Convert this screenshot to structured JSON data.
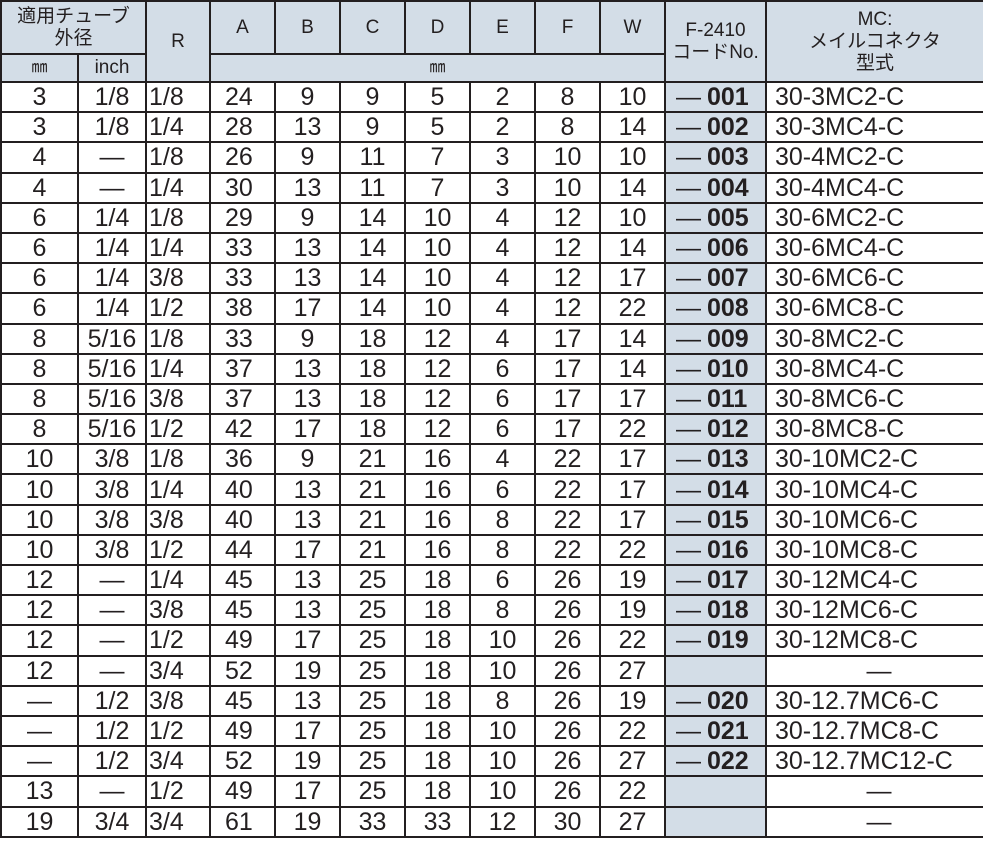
{
  "header": {
    "tube_od": "適用チューブ\n外径",
    "r": "R",
    "a": "A",
    "b": "B",
    "c": "C",
    "d": "D",
    "e": "E",
    "f": "F",
    "w": "W",
    "code": "F-2410\nコードNo.",
    "model": "MC:\nメイルコネクタ\n型式",
    "mm": "㎜",
    "inch": "inch",
    "dims_unit": "㎜"
  },
  "dash": "—",
  "rows": [
    {
      "mm": "3",
      "inch": "1/8",
      "r": "1/8",
      "a": "24",
      "b": "9",
      "c": "9",
      "d": "5",
      "e": "2",
      "f": "8",
      "w": "10",
      "code": "001",
      "model": "30-3MC2-C"
    },
    {
      "mm": "3",
      "inch": "1/8",
      "r": "1/4",
      "a": "28",
      "b": "13",
      "c": "9",
      "d": "5",
      "e": "2",
      "f": "8",
      "w": "14",
      "code": "002",
      "model": "30-3MC4-C"
    },
    {
      "mm": "4",
      "inch": "—",
      "r": "1/8",
      "a": "26",
      "b": "9",
      "c": "11",
      "d": "7",
      "e": "3",
      "f": "10",
      "w": "10",
      "code": "003",
      "model": "30-4MC2-C"
    },
    {
      "mm": "4",
      "inch": "—",
      "r": "1/4",
      "a": "30",
      "b": "13",
      "c": "11",
      "d": "7",
      "e": "3",
      "f": "10",
      "w": "14",
      "code": "004",
      "model": "30-4MC4-C"
    },
    {
      "mm": "6",
      "inch": "1/4",
      "r": "1/8",
      "a": "29",
      "b": "9",
      "c": "14",
      "d": "10",
      "e": "4",
      "f": "12",
      "w": "10",
      "code": "005",
      "model": "30-6MC2-C"
    },
    {
      "mm": "6",
      "inch": "1/4",
      "r": "1/4",
      "a": "33",
      "b": "13",
      "c": "14",
      "d": "10",
      "e": "4",
      "f": "12",
      "w": "14",
      "code": "006",
      "model": "30-6MC4-C"
    },
    {
      "mm": "6",
      "inch": "1/4",
      "r": "3/8",
      "a": "33",
      "b": "13",
      "c": "14",
      "d": "10",
      "e": "4",
      "f": "12",
      "w": "17",
      "code": "007",
      "model": "30-6MC6-C"
    },
    {
      "mm": "6",
      "inch": "1/4",
      "r": "1/2",
      "a": "38",
      "b": "17",
      "c": "14",
      "d": "10",
      "e": "4",
      "f": "12",
      "w": "22",
      "code": "008",
      "model": "30-6MC8-C"
    },
    {
      "mm": "8",
      "inch": "5/16",
      "r": "1/8",
      "a": "33",
      "b": "9",
      "c": "18",
      "d": "12",
      "e": "4",
      "f": "17",
      "w": "14",
      "code": "009",
      "model": "30-8MC2-C"
    },
    {
      "mm": "8",
      "inch": "5/16",
      "r": "1/4",
      "a": "37",
      "b": "13",
      "c": "18",
      "d": "12",
      "e": "6",
      "f": "17",
      "w": "14",
      "code": "010",
      "model": "30-8MC4-C"
    },
    {
      "mm": "8",
      "inch": "5/16",
      "r": "3/8",
      "a": "37",
      "b": "13",
      "c": "18",
      "d": "12",
      "e": "6",
      "f": "17",
      "w": "17",
      "code": "011",
      "model": "30-8MC6-C"
    },
    {
      "mm": "8",
      "inch": "5/16",
      "r": "1/2",
      "a": "42",
      "b": "17",
      "c": "18",
      "d": "12",
      "e": "6",
      "f": "17",
      "w": "22",
      "code": "012",
      "model": "30-8MC8-C"
    },
    {
      "mm": "10",
      "inch": "3/8",
      "r": "1/8",
      "a": "36",
      "b": "9",
      "c": "21",
      "d": "16",
      "e": "4",
      "f": "22",
      "w": "17",
      "code": "013",
      "model": "30-10MC2-C"
    },
    {
      "mm": "10",
      "inch": "3/8",
      "r": "1/4",
      "a": "40",
      "b": "13",
      "c": "21",
      "d": "16",
      "e": "6",
      "f": "22",
      "w": "17",
      "code": "014",
      "model": "30-10MC4-C"
    },
    {
      "mm": "10",
      "inch": "3/8",
      "r": "3/8",
      "a": "40",
      "b": "13",
      "c": "21",
      "d": "16",
      "e": "8",
      "f": "22",
      "w": "17",
      "code": "015",
      "model": "30-10MC6-C"
    },
    {
      "mm": "10",
      "inch": "3/8",
      "r": "1/2",
      "a": "44",
      "b": "17",
      "c": "21",
      "d": "16",
      "e": "8",
      "f": "22",
      "w": "22",
      "code": "016",
      "model": "30-10MC8-C"
    },
    {
      "mm": "12",
      "inch": "—",
      "r": "1/4",
      "a": "45",
      "b": "13",
      "c": "25",
      "d": "18",
      "e": "6",
      "f": "26",
      "w": "19",
      "code": "017",
      "model": "30-12MC4-C"
    },
    {
      "mm": "12",
      "inch": "—",
      "r": "3/8",
      "a": "45",
      "b": "13",
      "c": "25",
      "d": "18",
      "e": "8",
      "f": "26",
      "w": "19",
      "code": "018",
      "model": "30-12MC6-C"
    },
    {
      "mm": "12",
      "inch": "—",
      "r": "1/2",
      "a": "49",
      "b": "17",
      "c": "25",
      "d": "18",
      "e": "10",
      "f": "26",
      "w": "22",
      "code": "019",
      "model": "30-12MC8-C"
    },
    {
      "mm": "12",
      "inch": "—",
      "r": "3/4",
      "a": "52",
      "b": "19",
      "c": "25",
      "d": "18",
      "e": "10",
      "f": "26",
      "w": "27",
      "code": "",
      "model": "—"
    },
    {
      "mm": "—",
      "inch": "1/2",
      "r": "3/8",
      "a": "45",
      "b": "13",
      "c": "25",
      "d": "18",
      "e": "8",
      "f": "26",
      "w": "19",
      "code": "020",
      "model": "30-12.7MC6-C"
    },
    {
      "mm": "—",
      "inch": "1/2",
      "r": "1/2",
      "a": "49",
      "b": "17",
      "c": "25",
      "d": "18",
      "e": "10",
      "f": "26",
      "w": "22",
      "code": "021",
      "model": "30-12.7MC8-C"
    },
    {
      "mm": "—",
      "inch": "1/2",
      "r": "3/4",
      "a": "52",
      "b": "19",
      "c": "25",
      "d": "18",
      "e": "10",
      "f": "26",
      "w": "27",
      "code": "022",
      "model": "30-12.7MC12-C"
    },
    {
      "mm": "13",
      "inch": "—",
      "r": "1/2",
      "a": "49",
      "b": "17",
      "c": "25",
      "d": "18",
      "e": "10",
      "f": "26",
      "w": "22",
      "code": "",
      "model": "—"
    },
    {
      "mm": "19",
      "inch": "3/4",
      "r": "3/4",
      "a": "61",
      "b": "19",
      "c": "33",
      "d": "33",
      "e": "12",
      "f": "30",
      "w": "27",
      "code": "",
      "model": "—"
    }
  ]
}
